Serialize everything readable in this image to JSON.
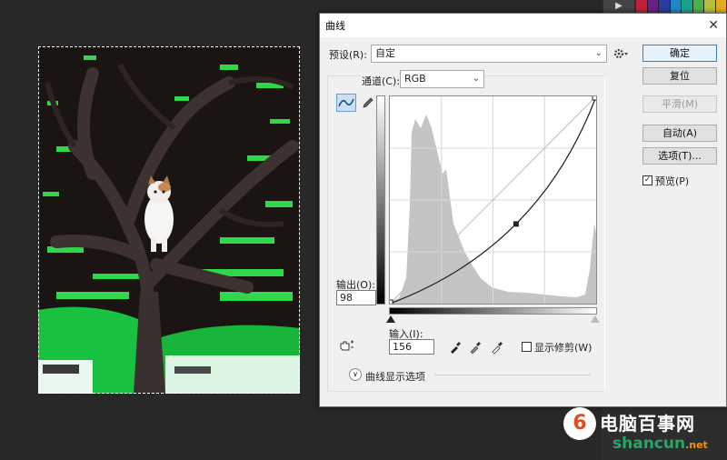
{
  "dialog": {
    "title": "曲线",
    "close_glyph": "✕",
    "preset_label": "预设(R):",
    "preset_value": "自定",
    "gear_icon": "gear-icon",
    "channel_label": "通道(C):",
    "channel_value": "RGB",
    "output_label": "输出(O):",
    "output_value": "98",
    "input_label": "输入(I):",
    "input_value": "156",
    "show_clipping_label": "显示修剪(W)",
    "show_clipping_checked": false,
    "curve_options_label": "曲线显示选项",
    "buttons": {
      "ok": "确定",
      "reset": "复位",
      "smooth": "平滑(M)",
      "auto": "自动(A)",
      "options": "选项(T)..."
    },
    "preview_label": "预览(P)",
    "preview_checked": true,
    "curve_point": {
      "input": 156,
      "output": 98
    }
  },
  "watermark": {
    "logo_glyph": "6",
    "name_cn": "电脑百事网",
    "name_en": "shancun",
    "tld": ".net"
  },
  "strip": {
    "button_glyph": "▶"
  },
  "colors": {
    "accent": "#3c7fb1",
    "workspace": "#282828",
    "dialog_bg": "#f0f0f0"
  }
}
